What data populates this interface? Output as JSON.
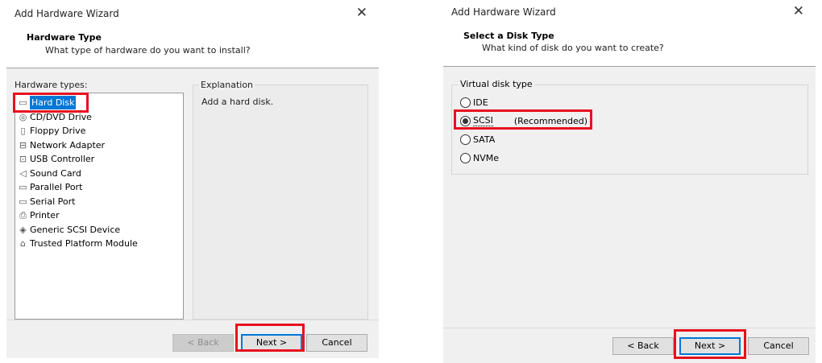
{
  "left": {
    "title": "Add Hardware Wizard",
    "close": "✕",
    "header": {
      "title": "Hardware Type",
      "subtitle": "What type of hardware do you want to install?"
    },
    "list_label": "Hardware types:",
    "items": [
      {
        "label": "Hard Disk",
        "icon": "hard-disk-icon",
        "glyph": "▭",
        "selected": true
      },
      {
        "label": "CD/DVD Drive",
        "icon": "cd-dvd-icon",
        "glyph": "◎"
      },
      {
        "label": "Floppy Drive",
        "icon": "floppy-icon",
        "glyph": "▯"
      },
      {
        "label": "Network Adapter",
        "icon": "network-adapter-icon",
        "glyph": "⊟"
      },
      {
        "label": "USB Controller",
        "icon": "usb-icon",
        "glyph": "⊡"
      },
      {
        "label": "Sound Card",
        "icon": "sound-card-icon",
        "glyph": "◁"
      },
      {
        "label": "Parallel Port",
        "icon": "parallel-port-icon",
        "glyph": "▭"
      },
      {
        "label": "Serial Port",
        "icon": "serial-port-icon",
        "glyph": "▭"
      },
      {
        "label": "Printer",
        "icon": "printer-icon",
        "glyph": "⎙"
      },
      {
        "label": "Generic SCSI Device",
        "icon": "scsi-device-icon",
        "glyph": "◈"
      },
      {
        "label": "Trusted Platform Module",
        "icon": "tpm-icon",
        "glyph": "⌂"
      }
    ],
    "explanation_label": "Explanation",
    "explanation_text": "Add a hard disk.",
    "buttons": {
      "back": "< Back",
      "next": "Next >",
      "cancel": "Cancel"
    }
  },
  "right": {
    "title": "Add Hardware Wizard",
    "close": "✕",
    "header": {
      "title": "Select a Disk Type",
      "subtitle": "What kind of disk do you want to create?"
    },
    "group_label": "Virtual disk type",
    "options": [
      {
        "label": "IDE",
        "checked": false,
        "note": ""
      },
      {
        "label": "SCSI",
        "checked": true,
        "note": "(Recommended)"
      },
      {
        "label": "SATA",
        "checked": false,
        "note": ""
      },
      {
        "label": "NVMe",
        "checked": false,
        "note": ""
      }
    ],
    "buttons": {
      "back": "< Back",
      "next": "Next >",
      "cancel": "Cancel"
    }
  },
  "colors": {
    "highlight": "#e8101f",
    "selection": "#0078d7",
    "dialog_bg": "#f0f0f0"
  }
}
